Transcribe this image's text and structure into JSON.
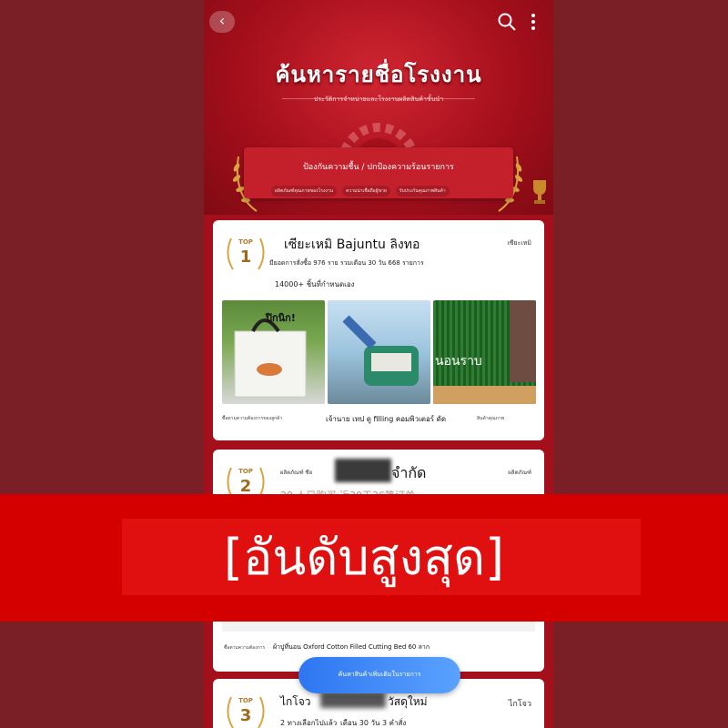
{
  "header": {
    "title": "ค้นหารายชื่อโรงงาน",
    "subtitle": "ประวัติการจำหน่ายและโรงงานผลิตสินค้าชั้นนำ",
    "back_icon": "chevron-left-icon",
    "search_icon": "search-icon",
    "more_icon": "more-vertical-icon"
  },
  "banner": {
    "title": "ป้องกันความชื้น / ปกป้องความร้อนรายการ",
    "pills": [
      "ผลิตภัณฑ์คุณภาพของโรงงาน",
      "ความน่าเชื่อถือผู้ขาย",
      "รับประกันคุณภาพสินค้า"
    ]
  },
  "cards": [
    {
      "rank_label": "TOP",
      "rank": "1",
      "name": "เซียะเหมิ Bajuntu ลิงทอ",
      "tag": "เซียะเหมิ",
      "stats": "มียอดการสั่งซื้อ 976 ราย รวมเดือน 30 วัน 668 รายการ",
      "meta": "14000+ ชิ้นที่กำหนดเอง",
      "images": [
        {
          "overlay": "ปิกนิก!"
        },
        {
          "overlay": ""
        },
        {
          "overlay": "นอนราบ"
        }
      ],
      "captions": [
        "ซื้อตามความต้องการของลูกค้า",
        "เจ้านาย เทป ดู filling คอมพิวเตอร์ ดัด",
        "สินค้าคุณภาพ"
      ]
    },
    {
      "rank_label": "TOP",
      "rank": "2",
      "name": "จำกัด",
      "prefix": "ผลิตภัณฑ์ ซือ",
      "tag": "ผลิตภัณฑ์",
      "stats": "29 人已购买 近30天36笔订单",
      "caption": "ผ้าปูที่นอน Oxford Cotton Filled Cutting Bed 60 ลาก",
      "caption_left": "ซื้อตามความต้องการ"
    },
    {
      "rank_label": "TOP",
      "rank": "3",
      "name": "ไกโจว",
      "name_suffix": "วัสดุใหม่",
      "tag": "ไกโจว",
      "stats_a": "2 ทางเลือกไปแล้ว",
      "stats_b": "เดือน 30 วัน 3 คำสั่ง"
    }
  ],
  "cta": {
    "label": "ค้นหาสินค้าเพิ่มเติมในรายการ"
  },
  "overlay": {
    "text": "[อันดับสูงสุด]"
  },
  "colors": {
    "primary_red": "#b3141f",
    "overlay_red": "#d40000",
    "cta_blue": "#2d76f0",
    "gold": "#b27a2a"
  }
}
